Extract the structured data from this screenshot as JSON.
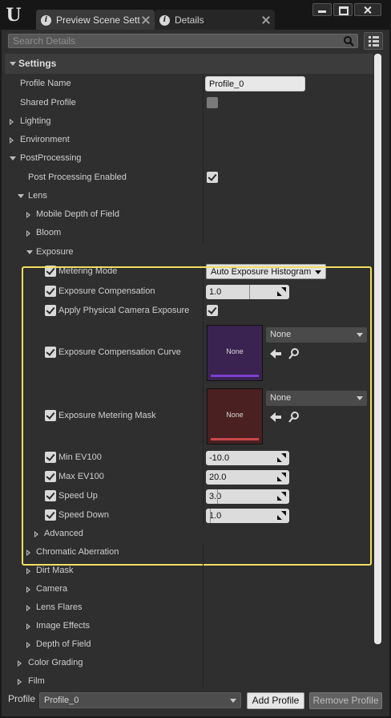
{
  "window": {
    "tabs": [
      {
        "label": "Preview Scene Sett",
        "active": true
      },
      {
        "label": "Details",
        "active": false
      }
    ]
  },
  "search": {
    "placeholder": "Search Details"
  },
  "settings": {
    "category_label": "Settings",
    "profile_name": {
      "label": "Profile Name",
      "value": "Profile_0"
    },
    "shared_profile": {
      "label": "Shared Profile",
      "checked": false
    },
    "lighting": "Lighting",
    "environment": "Environment",
    "postprocessing": "PostProcessing",
    "post_processing_enabled": {
      "label": "Post Processing Enabled",
      "checked": true
    },
    "lens": "Lens",
    "mobile_dof": "Mobile Depth of Field",
    "bloom": "Bloom",
    "exposure": {
      "label": "Exposure",
      "metering_mode": {
        "label": "Metering Mode",
        "value": "Auto Exposure Histogram"
      },
      "exposure_compensation": {
        "label": "Exposure Compensation",
        "value": "1.0"
      },
      "apply_physical_camera_exposure": {
        "label": "Apply Physical Camera Exposure",
        "checked": true
      },
      "compensation_curve": {
        "label": "Exposure Compensation Curve",
        "thumb_text": "None",
        "asset": "None",
        "thumb_color": "#3a2350",
        "bar_color": "#7b3fd0"
      },
      "metering_mask": {
        "label": "Exposure Metering Mask",
        "thumb_text": "None",
        "asset": "None",
        "thumb_color": "#4a2020",
        "bar_color": "#c84848"
      },
      "min_ev100": {
        "label": "Min EV100",
        "value": "-10.0"
      },
      "max_ev100": {
        "label": "Max EV100",
        "value": "20.0"
      },
      "speed_up": {
        "label": "Speed Up",
        "value": "3.0"
      },
      "speed_down": {
        "label": "Speed Down",
        "value": "1.0"
      },
      "advanced": "Advanced"
    },
    "chromatic_aberration": "Chromatic Aberration",
    "dirt_mask": "Dirt Mask",
    "camera": "Camera",
    "lens_flares": "Lens Flares",
    "image_effects": "Image Effects",
    "depth_of_field": "Depth of Field",
    "color_grading": "Color Grading",
    "film": "Film"
  },
  "footer": {
    "profile_label": "Profile",
    "profile_value": "Profile_0",
    "add_profile": "Add Profile",
    "remove_profile": "Remove Profile"
  },
  "colors": {
    "highlight": "#f0e060",
    "panel": "#2f2f2f"
  }
}
